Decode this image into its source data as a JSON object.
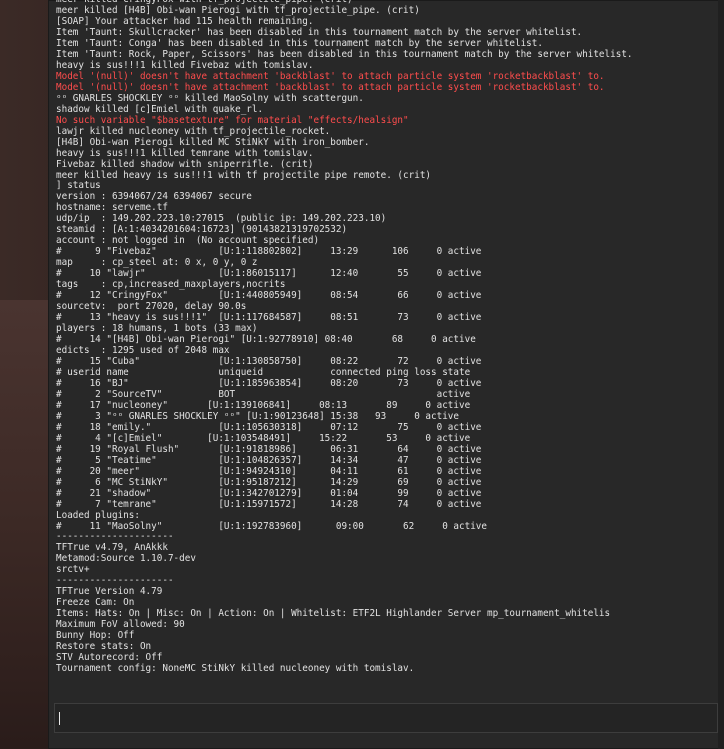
{
  "colors": {
    "text": "#e2e2e2",
    "error": "#ff4d4d",
    "console_bg": "#282828"
  },
  "console": {
    "input_value": "",
    "lines": [
      {
        "text": "meer killed CringyFox with tf_projectile_pipe. (crit)",
        "type": "normal"
      },
      {
        "text": "meer killed [H4B] Obi-wan Pierogi with tf_projectile_pipe. (crit)",
        "type": "normal"
      },
      {
        "text": "[SOAP] Your attacker had 115 health remaining.",
        "type": "normal"
      },
      {
        "text": "Item 'Taunt: Skullcracker' has been disabled in this tournament match by the server whitelist.",
        "type": "normal"
      },
      {
        "text": "Item 'Taunt: Conga' has been disabled in this tournament match by the server whitelist.",
        "type": "normal"
      },
      {
        "text": "Item 'Taunt: Rock, Paper, Scissors' has been disabled in this tournament match by the server whitelist.",
        "type": "normal"
      },
      {
        "text": "heavy is sus!!!1 killed Fivebaz with tomislav.",
        "type": "normal"
      },
      {
        "text": "Model '(null)' doesn't have attachment 'backblast' to attach particle system 'rocketbackblast' to.",
        "type": "error"
      },
      {
        "text": "Model '(null)' doesn't have attachment 'backblast' to attach particle system 'rocketbackblast' to.",
        "type": "error"
      },
      {
        "text": "ᵒᵒ GNARLES SHOCKLEY ᵒᵒ killed MaoSolny with scattergun.",
        "type": "normal"
      },
      {
        "text": "shadow killed [c]Emiel with quake_rl.",
        "type": "normal"
      },
      {
        "text": "No such variable \"$basetexture\" for material \"effects/healsign\"",
        "type": "error"
      },
      {
        "text": "lawjr killed nucleoney with tf_projectile_rocket.",
        "type": "normal"
      },
      {
        "text": "[H4B] Obi-wan Pierogi killed MC StiNkY with iron_bomber.",
        "type": "normal"
      },
      {
        "text": "heavy is sus!!!1 killed temrane with tomislav.",
        "type": "normal"
      },
      {
        "text": "Fivebaz killed shadow with sniperrifle. (crit)",
        "type": "normal"
      },
      {
        "text": "meer killed heavy is sus!!!1 with tf_projectile_pipe_remote. (crit)",
        "type": "normal"
      },
      {
        "text": "] status",
        "type": "normal"
      },
      {
        "text": "version : 6394067/24 6394067 secure",
        "type": "normal"
      },
      {
        "text": "hostname: serveme.tf",
        "type": "normal"
      },
      {
        "text": "udp/ip  : 149.202.223.10:27015  (public ip: 149.202.223.10)",
        "type": "normal"
      },
      {
        "text": "steamid : [A:1:4034201604:16723] (90143821319702532)",
        "type": "normal"
      },
      {
        "text": "account : not logged in  (No account specified)",
        "type": "normal"
      },
      {
        "text": "#      9 \"Fivebaz\"           [U:1:118802802]     13:29      106     0 active",
        "type": "normal"
      },
      {
        "text": "map     : cp_steel at: 0 x, 0 y, 0 z",
        "type": "normal"
      },
      {
        "text": "#     10 \"lawjr\"             [U:1:86015117]      12:40       55     0 active",
        "type": "normal"
      },
      {
        "text": "tags    : cp,increased_maxplayers,nocrits",
        "type": "normal"
      },
      {
        "text": "#     12 \"CringyFox\"         [U:1:440805949]     08:54       66     0 active",
        "type": "normal"
      },
      {
        "text": "sourcetv:  port 27020, delay 90.0s",
        "type": "normal"
      },
      {
        "text": "#     13 \"heavy is sus!!!1\"  [U:1:117684587]     08:51       73     0 active",
        "type": "normal"
      },
      {
        "text": "players : 18 humans, 1 bots (33 max)",
        "type": "normal"
      },
      {
        "text": "#     14 \"[H4B] Obi-wan Pierogi\" [U:1:92778910] 08:40       68     0 active",
        "type": "normal"
      },
      {
        "text": "edicts  : 1295 used of 2048 max",
        "type": "normal"
      },
      {
        "text": "#     15 \"Cuba\"              [U:1:130858750]     08:22       72     0 active",
        "type": "normal"
      },
      {
        "text": "# userid name                uniqueid            connected ping loss state",
        "type": "normal"
      },
      {
        "text": "#     16 \"BJ\"                [U:1:185963854]     08:20       73     0 active",
        "type": "normal"
      },
      {
        "text": "#      2 \"SourceTV\"          BOT                                    active",
        "type": "normal"
      },
      {
        "text": "#     17 \"nucleoney\"       [U:1:139106841]     08:13       89     0 active",
        "type": "normal"
      },
      {
        "text": "#      3 \"ᵒᵒ GNARLES SHOCKLEY ᵒᵒ\" [U:1:90123648] 15:38   93     0 active",
        "type": "normal"
      },
      {
        "text": "#     18 \"emily.\"            [U:1:105630318]     07:12       75     0 active",
        "type": "normal"
      },
      {
        "text": "#      4 \"[c]Emiel\"        [U:1:103548491]     15:22       53     0 active",
        "type": "normal"
      },
      {
        "text": "#     19 \"Royal Flush\"       [U:1:91818986]      06:31       64     0 active",
        "type": "normal"
      },
      {
        "text": "#      5 \"Teatime\"           [U:1:104826357]     14:34       47     0 active",
        "type": "normal"
      },
      {
        "text": "#     20 \"meer\"              [U:1:94924310]      04:11       61     0 active",
        "type": "normal"
      },
      {
        "text": "#      6 \"MC StiNkY\"         [U:1:95187212]      14:29       69     0 active",
        "type": "normal"
      },
      {
        "text": "#     21 \"shadow\"            [U:1:342701279]     01:04       99     0 active",
        "type": "normal"
      },
      {
        "text": "#      7 \"temrane\"           [U:1:15971572]      14:28       74     0 active",
        "type": "normal"
      },
      {
        "text": "Loaded plugins:",
        "type": "normal"
      },
      {
        "text": "#     11 \"MaoSolny\"          [U:1:192783960]      09:00       62     0 active",
        "type": "normal"
      },
      {
        "text": "---------------------",
        "type": "normal"
      },
      {
        "text": "TFTrue v4.79, AnAkkk",
        "type": "normal"
      },
      {
        "text": "Metamod:Source 1.10.7-dev",
        "type": "normal"
      },
      {
        "text": "srctv+",
        "type": "normal"
      },
      {
        "text": "---------------------",
        "type": "normal"
      },
      {
        "text": "TFTrue Version 4.79",
        "type": "normal"
      },
      {
        "text": "Freeze Cam: On",
        "type": "normal"
      },
      {
        "text": "Items: Hats: On | Misc: On | Action: On | Whitelist: ETF2L Highlander Server mp_tournament_whitelis",
        "type": "normal"
      },
      {
        "text": "Maximum FoV allowed: 90",
        "type": "normal"
      },
      {
        "text": "Bunny Hop: Off",
        "type": "normal"
      },
      {
        "text": "Restore stats: On",
        "type": "normal"
      },
      {
        "text": "STV Autorecord: Off",
        "type": "normal"
      },
      {
        "text": "Tournament config: NoneMC StiNkY killed nucleoney with tomislav.",
        "type": "normal"
      }
    ]
  }
}
